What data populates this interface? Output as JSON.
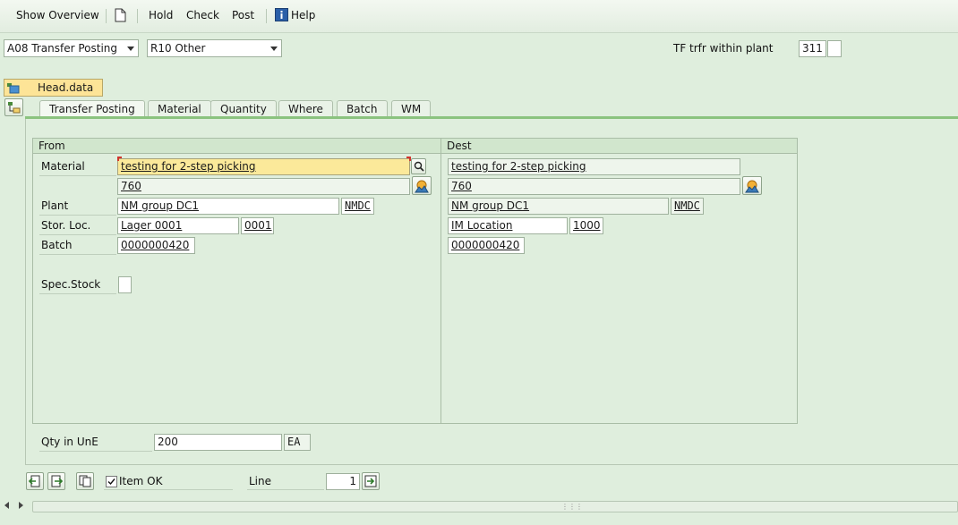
{
  "toolbar": {
    "show_overview": "Show Overview",
    "new_icon": "document-icon",
    "hold": "Hold",
    "check": "Check",
    "post": "Post",
    "help": "Help",
    "help_icon": "info-icon"
  },
  "header": {
    "action_value": "A08 Transfer Posting",
    "reference_value": "R10 Other",
    "movement_label": "TF trfr within plant",
    "movement_type": "311",
    "special_indicator": ""
  },
  "head_data_button": "Head.data",
  "tabs": [
    {
      "label": "Transfer Posting",
      "active": true
    },
    {
      "label": "Material",
      "active": false
    },
    {
      "label": "Quantity",
      "active": false
    },
    {
      "label": "Where",
      "active": false
    },
    {
      "label": "Batch",
      "active": false
    },
    {
      "label": "WM",
      "active": false
    }
  ],
  "from": {
    "title": "From",
    "labels": {
      "material": "Material",
      "plant": "Plant",
      "stor_loc": "Stor. Loc.",
      "batch": "Batch",
      "spec_stock": "Spec.Stock"
    },
    "material_desc": "testing for 2-step picking",
    "material_no": "760",
    "plant_name": "NM group DC1",
    "plant_code": "NMDC",
    "sloc_name": "Lager 0001",
    "sloc_code": "0001",
    "batch": "0000000420",
    "spec_stock": ""
  },
  "dest": {
    "title": "Dest",
    "material_desc": "testing for 2-step picking",
    "material_no": "760",
    "plant_name": "NM group DC1",
    "plant_code": "NMDC",
    "sloc_name": "IM Location",
    "sloc_code": "1000",
    "batch": "0000000420"
  },
  "quantity": {
    "label": "Qty in UnE",
    "value": "200",
    "unit": "EA"
  },
  "footer": {
    "item_ok_label": "Item OK",
    "item_ok_checked": true,
    "line_label": "Line",
    "line_value": "1"
  },
  "colors": {
    "background": "#dfeedd",
    "focus_field": "#fbe99a",
    "tab_accent": "#8bc37f"
  }
}
